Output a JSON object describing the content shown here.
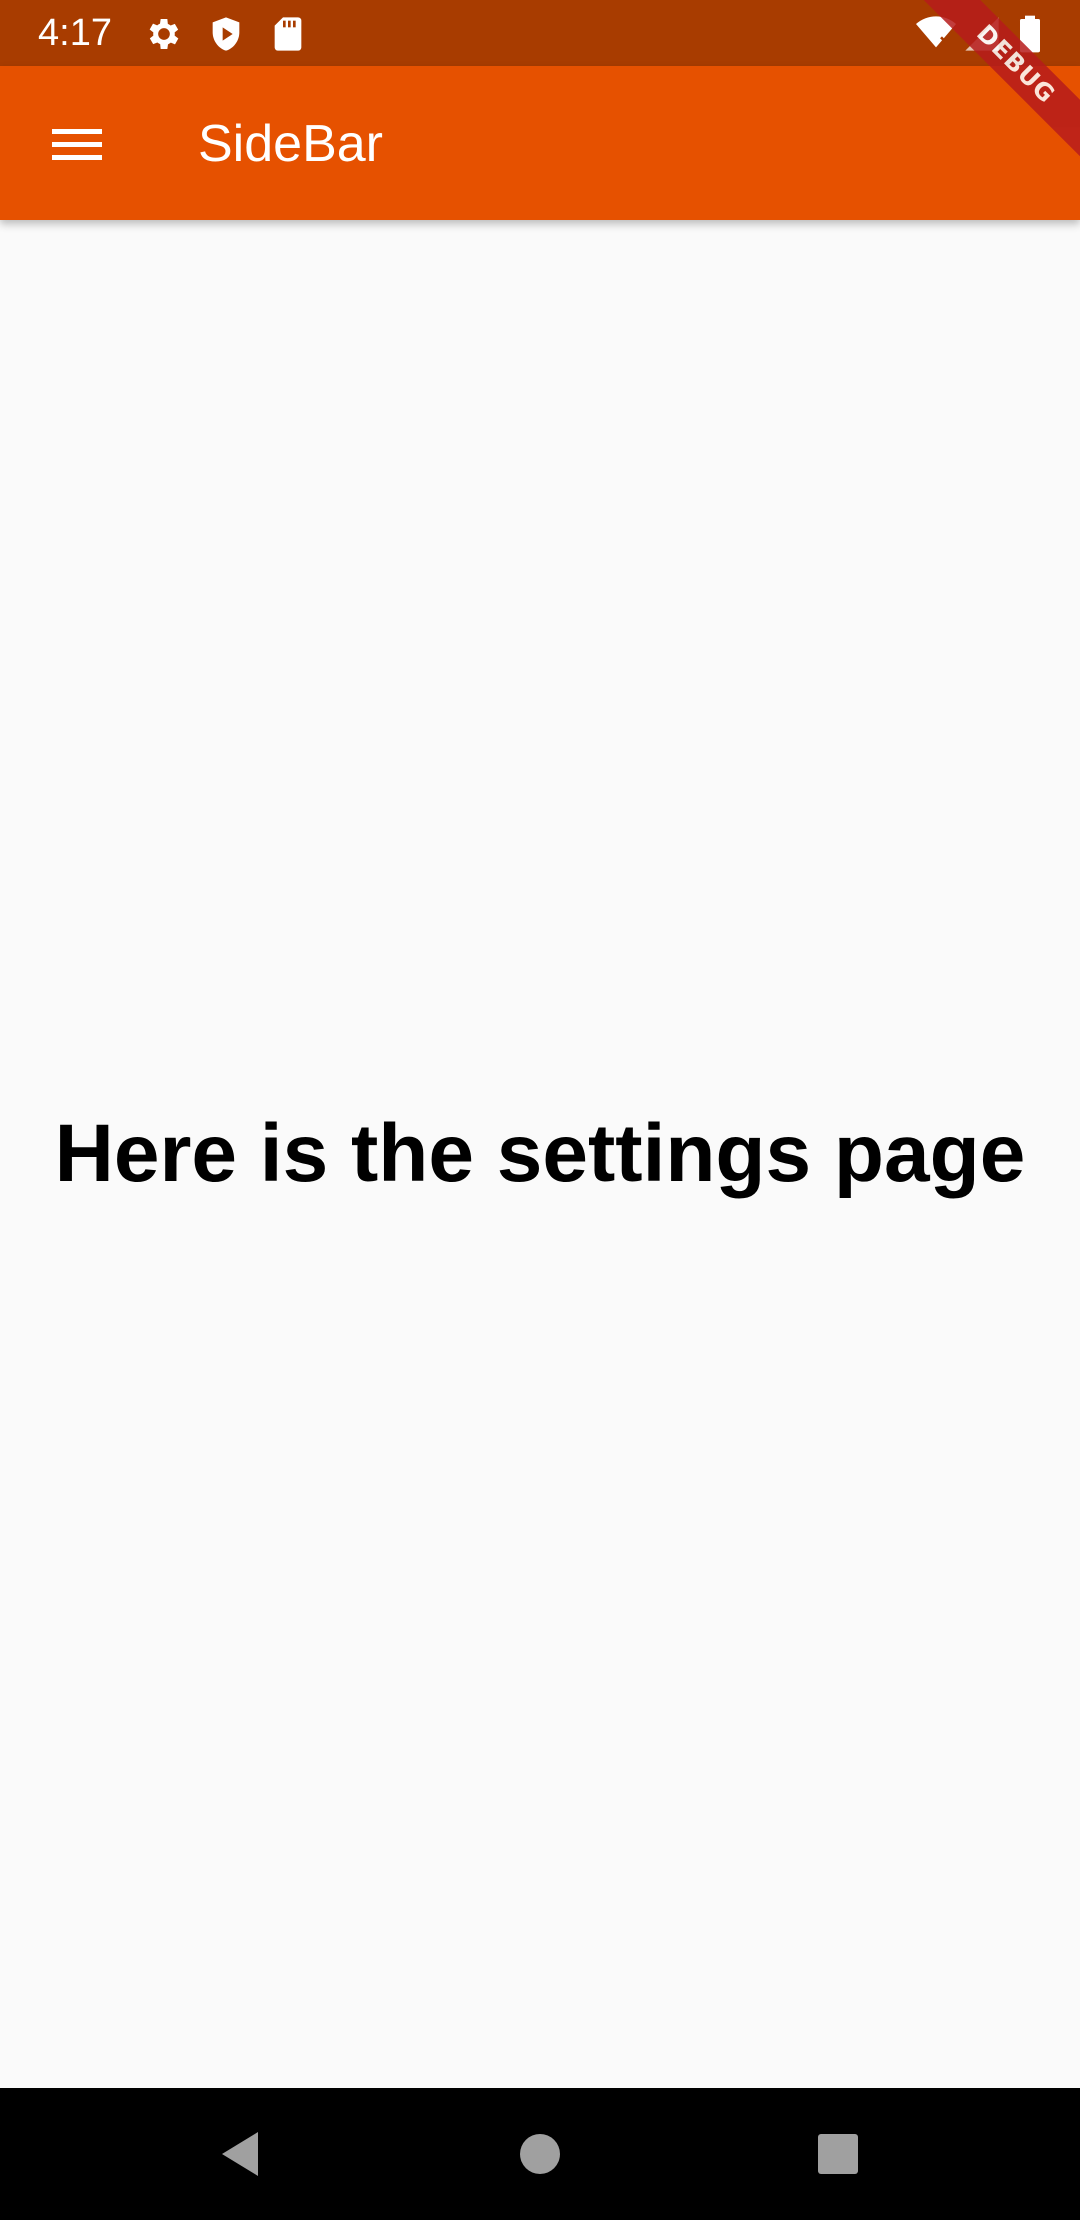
{
  "status_bar": {
    "time": "4:17",
    "icons_left": [
      "settings-icon",
      "shield-play-icon",
      "sd-card-icon"
    ],
    "icons_right": [
      "wifi-off-icon",
      "signal-icon",
      "battery-icon"
    ]
  },
  "app_bar": {
    "menu_icon": "menu-icon",
    "title": "SideBar",
    "color": "#e65100"
  },
  "debug_banner": {
    "label": "DEBUG"
  },
  "main": {
    "heading": "Here is the settings page"
  },
  "nav_bar": {
    "buttons": [
      "back-icon",
      "home-icon",
      "recents-icon"
    ]
  }
}
